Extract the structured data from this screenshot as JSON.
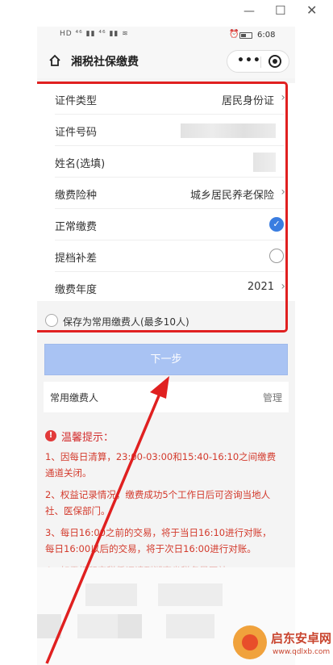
{
  "window": {
    "minimize_glyph": "—",
    "maximize_glyph": "☐",
    "close_glyph": "✕"
  },
  "statusbar": {
    "left_icons": "HD ⁴⁶ ▮▮ ⁴⁶ ▮▮ ≋",
    "time": "6:08"
  },
  "navbar": {
    "title": "湘税社保缴费",
    "more_glyph": "•••"
  },
  "form": {
    "rows": [
      {
        "label": "证件类型",
        "value": "居民身份证"
      },
      {
        "label": "证件号码",
        "value": ""
      },
      {
        "label": "姓名(选填)",
        "value": ""
      },
      {
        "label": "缴费险种",
        "value": "城乡居民养老保险"
      },
      {
        "label": "正常缴费",
        "checked": true
      },
      {
        "label": "提档补差",
        "checked": false
      },
      {
        "label": "缴费年度",
        "value": "2021"
      }
    ],
    "save_label": "保存为常用缴费人(最多10人)"
  },
  "next_button": "下一步",
  "payer": {
    "label": "常用缴费人",
    "manage": "管理"
  },
  "tips": {
    "title": "温馨提示：",
    "items": [
      "1、因每日清算，23:00-03:00和15:40-16:10之间缴费通道关闭。",
      "2、权益记录情况，缴费成功5个工作日后可咨询当地人社、医保部门。",
      "3、每日16:00之前的交易，将于当日16:10进行对账，每日16:00以后的交易，将于次日16:00进行对账。",
      "4、如需打印完税凭证请到湖南省税务局网站"
    ]
  },
  "watermark": {
    "name": "启东安卓网",
    "url": "www.qdlxb.com"
  },
  "colors": {
    "highlight": "#e02020",
    "button": "#a9c3f3",
    "check": "#3a7de0",
    "tip_text": "#d33a2c",
    "arrow": "#e02020"
  }
}
